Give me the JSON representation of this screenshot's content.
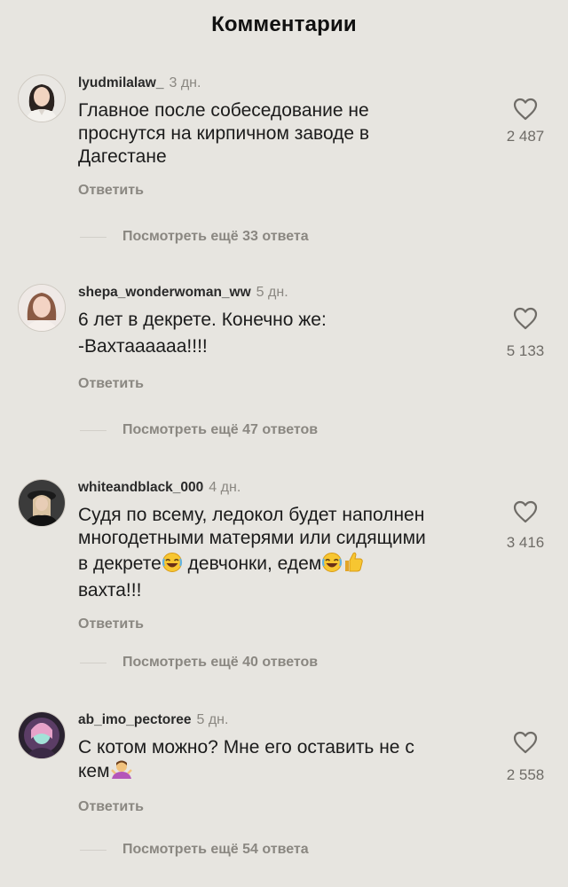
{
  "header": {
    "title": "Комментарии"
  },
  "icons": {
    "like": "heart-outline-icon",
    "avatar": "profile-photo"
  },
  "comments": [
    {
      "username": "lyudmilalaw_",
      "time": "3 дн.",
      "text": "Главное после собеседование не\nпроснутся на кирпичном заводе в\nДагестане",
      "likes": "2 487",
      "reply_label": "Ответить",
      "more_replies": "Посмотреть ещё 33 ответа"
    },
    {
      "username": "shepa_wonderwoman_ww",
      "time": "5 дн.",
      "text": "6 лет в декрете. Конечно же:\n-Вахтаааааа!!!!",
      "likes": "5 133",
      "reply_label": "Ответить",
      "more_replies": "Посмотреть ещё 47 ответов"
    },
    {
      "username": "whiteandblack_000",
      "time": "4 дн.",
      "text_line1": "Судя по всему, ледокол будет наполнен",
      "text_line2": "многодетными матерями или сидящими",
      "text_line3a": "в декрете",
      "text_line3b": " девчонки, едем",
      "text_line4": "вахта!!!",
      "emoji_1": "laughing-emoji",
      "emoji_2": "laughing-emoji",
      "emoji_3": "thumbs-up-emoji",
      "likes": "3 416",
      "reply_label": "Ответить",
      "more_replies": "Посмотреть ещё 40 ответов"
    },
    {
      "username": "ab_imo_pectoree",
      "time": "5 дн.",
      "text_line1": "С котом можно? Мне его оставить не с",
      "text_line2": "кем",
      "emoji_1": "person-shrugging-emoji",
      "likes": "2 558",
      "reply_label": "Ответить",
      "more_replies": "Посмотреть ещё 54 ответа"
    }
  ]
}
